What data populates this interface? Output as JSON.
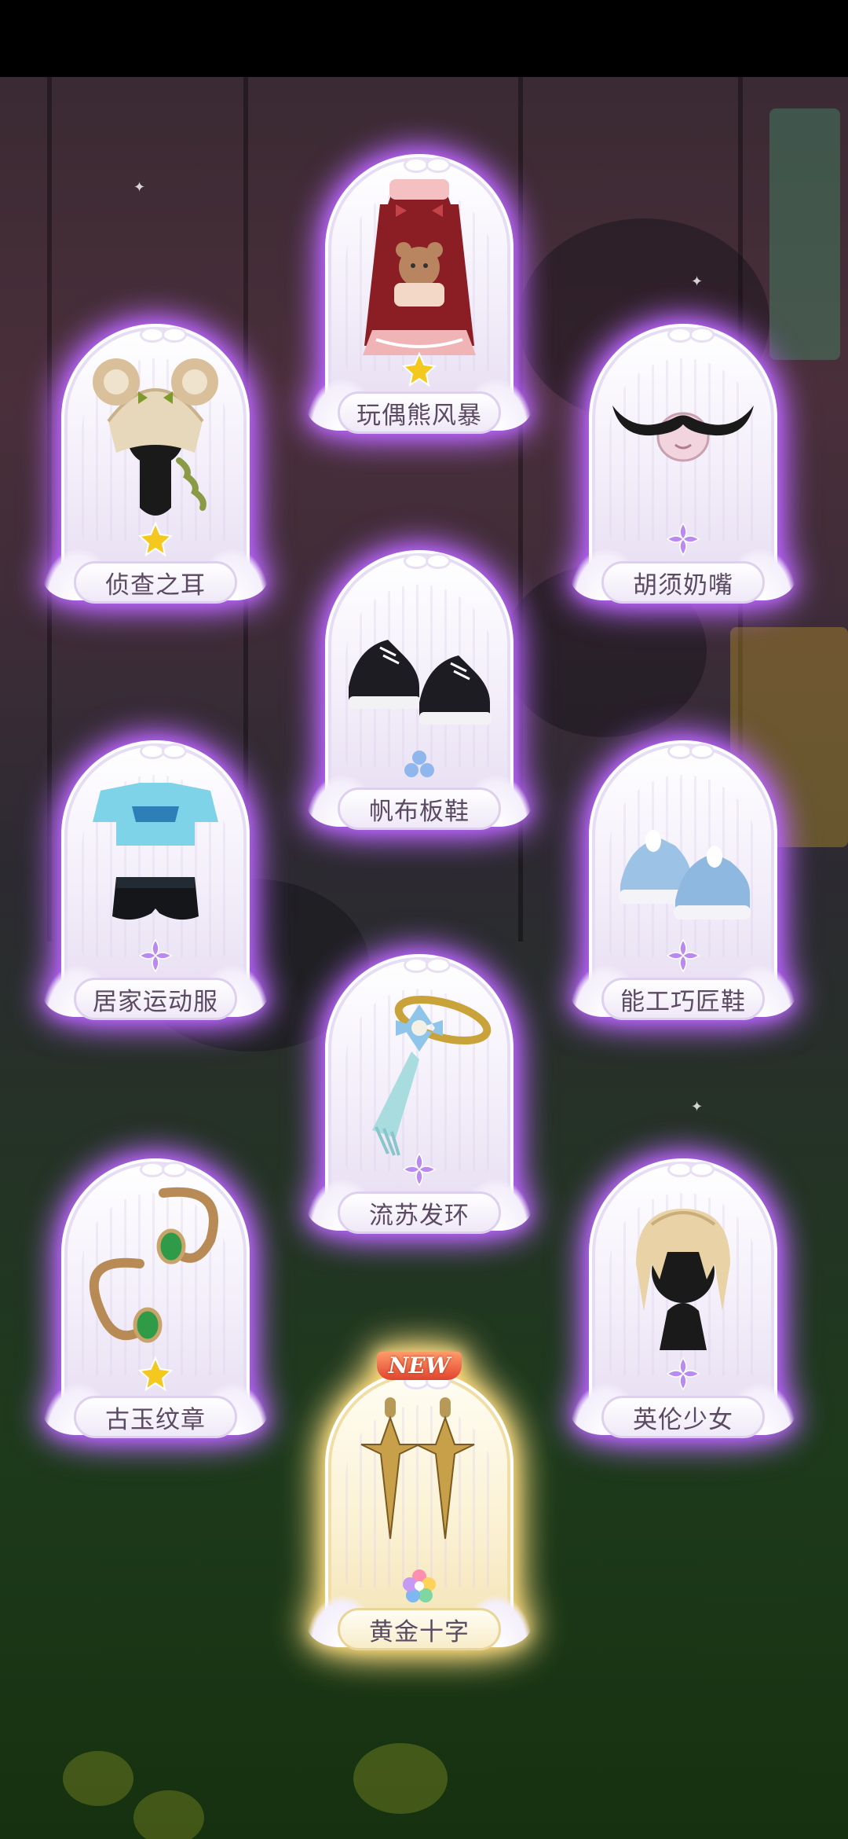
{
  "cards": [
    {
      "label": "玩偶熊风暴",
      "rarity": "gold",
      "icon": "bear-dress-icon"
    },
    {
      "label": "侦查之耳",
      "rarity": "gold",
      "icon": "plaid-bear-ear-hat-icon"
    },
    {
      "label": "胡须奶嘴",
      "rarity": "purple",
      "icon": "mustache-pacifier-icon"
    },
    {
      "label": "帆布板鞋",
      "rarity": "blue",
      "icon": "canvas-sneakers-icon"
    },
    {
      "label": "居家运动服",
      "rarity": "purple",
      "icon": "sport-outfit-icon"
    },
    {
      "label": "能工巧匠鞋",
      "rarity": "purple",
      "icon": "blue-shoes-icon"
    },
    {
      "label": "流苏发环",
      "rarity": "purple",
      "icon": "tassel-hairpin-icon"
    },
    {
      "label": "古玉纹章",
      "rarity": "gold",
      "icon": "jade-earrings-icon"
    },
    {
      "label": "英伦少女",
      "rarity": "purple",
      "icon": "blonde-hair-icon"
    },
    {
      "label": "黄金十字",
      "rarity": "rainbow",
      "icon": "gold-cross-earrings-icon",
      "badge": "NEW"
    }
  ],
  "colors": {
    "glow_purple": "#b455ff",
    "glow_gold": "#ffd56a",
    "rarity_gold": "#f5c81f",
    "rarity_purple": "#b98af0",
    "rarity_blue": "#8fb7ee"
  }
}
